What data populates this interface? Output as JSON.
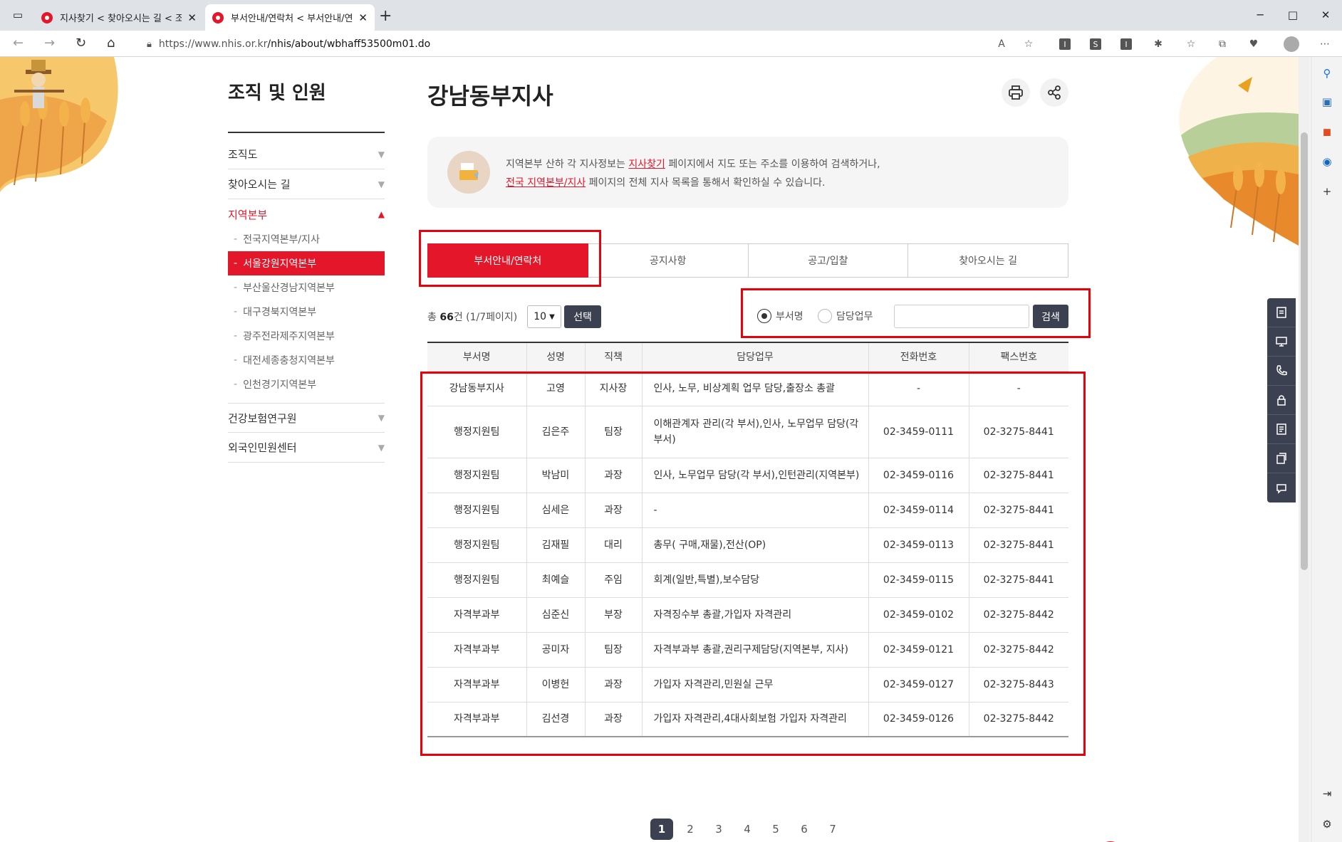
{
  "browser": {
    "tabs": [
      {
        "label": "지사찾기 < 찾아오시는 길 < 조직",
        "active": false
      },
      {
        "label": "부서안내/연락처 < 부서안내/연락",
        "active": true
      }
    ],
    "url_host": "https://www.nhis.or.kr",
    "url_path": "/nhis/about/wbhaff53500m01.do"
  },
  "sidebar": {
    "title": "조직 및 인원",
    "items": [
      {
        "label": "조직도"
      },
      {
        "label": "찾아오시는 길"
      },
      {
        "label": "지역본부"
      },
      {
        "label": "건강보험연구원"
      },
      {
        "label": "외국인민원센터"
      }
    ],
    "sub_items": [
      {
        "label": "전국지역본부/지사"
      },
      {
        "label": "서울강원지역본부"
      },
      {
        "label": "부산울산경남지역본부"
      },
      {
        "label": "대구경북지역본부"
      },
      {
        "label": "광주전라제주지역본부"
      },
      {
        "label": "대전세종충청지역본부"
      },
      {
        "label": "인천경기지역본부"
      }
    ]
  },
  "main": {
    "title": "강남동부지사",
    "info": {
      "line1_pre": "지역본부 산하 각 지사정보는 ",
      "line1_link": "지사찾기",
      "line1_post": " 페이지에서 지도 또는 주소를 이용하여 검색하거나,",
      "line2_link": "전국 지역본부/지사",
      "line2_post": " 페이지의 전체 지사 목록을 통해서 확인하실 수 있습니다."
    },
    "tabs": [
      {
        "label": "부서안내/연락처"
      },
      {
        "label": "공지사항"
      },
      {
        "label": "공고/입찰"
      },
      {
        "label": "찾아오시는 길"
      }
    ],
    "count_prefix": "총 ",
    "count_total": "66",
    "count_suffix": "건 (1/7페이지)",
    "page_size": "10",
    "select_label": "선택",
    "search": {
      "radio_dept": "부서명",
      "radio_duty": "담당업무",
      "button": "검색"
    },
    "table": {
      "headers": [
        "부서명",
        "성명",
        "직책",
        "담당업무",
        "전화번호",
        "팩스번호"
      ],
      "rows": [
        [
          "강남동부지사",
          "고영",
          "지사장",
          "인사, 노무, 비상계획 업무 담당,출장소 총괄",
          "-",
          "-"
        ],
        [
          "행정지원팀",
          "김은주",
          "팀장",
          "이해관계자 관리(각 부서),인사, 노무업무 담당(각 부서)",
          "02-3459-0111",
          "02-3275-8441"
        ],
        [
          "행정지원팀",
          "박남미",
          "과장",
          "인사, 노무업무 담당(각 부서),인턴관리(지역본부)",
          "02-3459-0116",
          "02-3275-8441"
        ],
        [
          "행정지원팀",
          "심세은",
          "과장",
          "-",
          "02-3459-0114",
          "02-3275-8441"
        ],
        [
          "행정지원팀",
          "김재필",
          "대리",
          "총무( 구매,재물),전산(OP)",
          "02-3459-0113",
          "02-3275-8441"
        ],
        [
          "행정지원팀",
          "최예슬",
          "주임",
          "회계(일반,특별),보수담당",
          "02-3459-0115",
          "02-3275-8441"
        ],
        [
          "자격부과부",
          "심준신",
          "부장",
          "자격징수부 총괄,가입자 자격관리",
          "02-3459-0102",
          "02-3275-8442"
        ],
        [
          "자격부과부",
          "공미자",
          "팀장",
          "자격부과부 총괄,권리구제담당(지역본부, 지사)",
          "02-3459-0121",
          "02-3275-8442"
        ],
        [
          "자격부과부",
          "이병헌",
          "과장",
          "가입자 자격관리,민원실 근무",
          "02-3459-0127",
          "02-3275-8443"
        ],
        [
          "자격부과부",
          "김선경",
          "과장",
          "가입자 자격관리,4대사회보험 가입자 자격관리",
          "02-3459-0126",
          "02-3275-8442"
        ]
      ]
    },
    "pagination": [
      "1",
      "2",
      "3",
      "4",
      "5",
      "6",
      "7"
    ],
    "current_page": "1"
  },
  "colors": {
    "brand_red": "#e4172a",
    "highlight_red": "#e8000b",
    "dark_button": "#3c4152"
  }
}
